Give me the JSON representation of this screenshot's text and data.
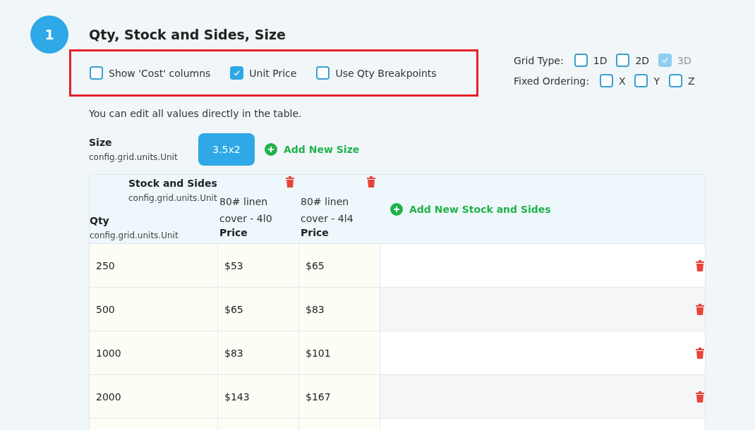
{
  "step": "1",
  "title": "Qty, Stock and Sides, Size",
  "options": [
    {
      "label": "Show 'Cost' columns",
      "checked": false
    },
    {
      "label": "Unit Price",
      "checked": true
    },
    {
      "label": "Use Qty Breakpoints",
      "checked": false
    }
  ],
  "grid_type": {
    "label": "Grid Type:",
    "options": [
      {
        "label": "1D",
        "checked": false,
        "disabled": false
      },
      {
        "label": "2D",
        "checked": false,
        "disabled": false
      },
      {
        "label": "3D",
        "checked": true,
        "disabled": true
      }
    ]
  },
  "fixed_ordering": {
    "label": "Fixed Ordering:",
    "options": [
      {
        "label": "X",
        "checked": false,
        "disabled": false
      },
      {
        "label": "Y",
        "checked": false,
        "disabled": false
      },
      {
        "label": "Z",
        "checked": false,
        "disabled": false
      }
    ]
  },
  "hint": "You can edit all values directly in the table.",
  "size": {
    "label": "Size",
    "unit": "config.grid.units.Unit",
    "values": [
      {
        "label": "3.5x2",
        "selected": true
      }
    ],
    "add": "Add New Size"
  },
  "table": {
    "stock_label": "Stock and Sides",
    "stock_unit": "config.grid.units.Unit",
    "qty_label": "Qty",
    "qty_unit": "config.grid.units.Unit",
    "columns": [
      {
        "name": "80# linen cover - 4l0",
        "price_label": "Price"
      },
      {
        "name": "80# linen cover - 4l4",
        "price_label": "Price"
      }
    ],
    "add_column": "Add New Stock and Sides",
    "rows": [
      {
        "qty": "250",
        "prices": [
          "$53",
          "$65"
        ]
      },
      {
        "qty": "500",
        "prices": [
          "$65",
          "$83"
        ]
      },
      {
        "qty": "1000",
        "prices": [
          "$83",
          "$101"
        ]
      },
      {
        "qty": "2000",
        "prices": [
          "$143",
          "$167"
        ]
      }
    ]
  }
}
